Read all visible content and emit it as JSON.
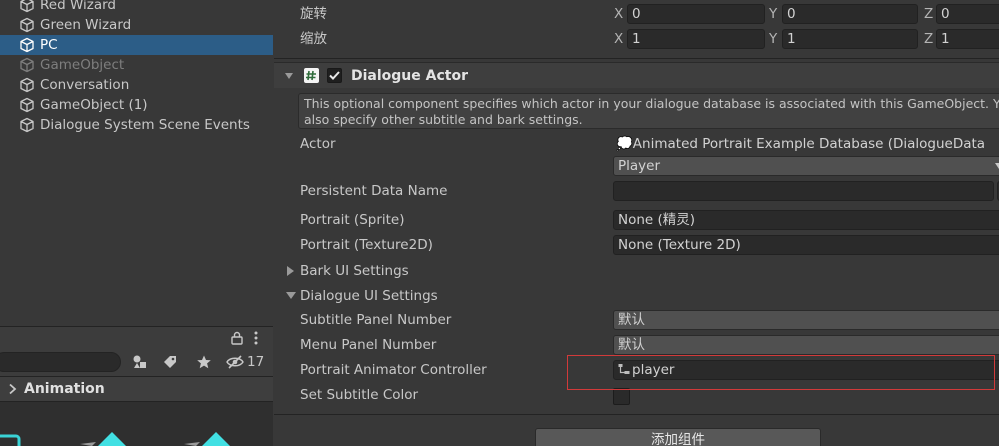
{
  "hierarchy": {
    "items": [
      {
        "label": "Red Wizard"
      },
      {
        "label": "Green Wizard"
      },
      {
        "label": "PC"
      },
      {
        "label": "GameObject"
      },
      {
        "label": "Conversation"
      },
      {
        "label": "GameObject (1)"
      },
      {
        "label": "Dialogue System Scene Events"
      }
    ]
  },
  "project": {
    "hidden_count": "17"
  },
  "animation": {
    "tab_label": "Animation"
  },
  "transform": {
    "rotation": {
      "label": "旋转",
      "x_axis": "X",
      "x": "0",
      "y_axis": "Y",
      "y": "0",
      "z_axis": "Z",
      "z": "0"
    },
    "scale": {
      "label": "缩放",
      "x_axis": "X",
      "x": "1",
      "y_axis": "Y",
      "y": "1",
      "z_axis": "Z",
      "z": "1"
    }
  },
  "component": {
    "title": "Dialogue Actor",
    "help_line1": "This optional component specifies which actor in your dialogue database is associated with this GameObject. Y",
    "help_line2": "also specify other subtitle and bark settings.",
    "actor_label": "Actor",
    "actor_database": "💭Animated Portrait Example Database (DialogueData",
    "actor_value": "Player",
    "persistent_label": "Persistent Data Name",
    "persistent_value": "",
    "portrait_sprite_label": "Portrait (Sprite)",
    "portrait_sprite_value": "None (精灵)",
    "portrait_tex_label": "Portrait (Texture2D)",
    "portrait_tex_value": "None (Texture 2D)",
    "bark_ui_label": "Bark UI Settings",
    "dialogue_ui_label": "Dialogue UI Settings",
    "subtitle_panel_label": "Subtitle Panel Number",
    "subtitle_panel_value": "默认",
    "menu_panel_label": "Menu Panel Number",
    "menu_panel_value": "默认",
    "portrait_anim_label": "Portrait Animator Controller",
    "portrait_anim_value": "player",
    "subtitle_color_label": "Set Subtitle Color"
  },
  "footer": {
    "add_component_label": "添加组件"
  },
  "colors": {
    "selection": "#2c5d87",
    "highlight_border": "#d23a3a",
    "panel_bg": "#383838",
    "field_bg": "#2a2a2a"
  }
}
